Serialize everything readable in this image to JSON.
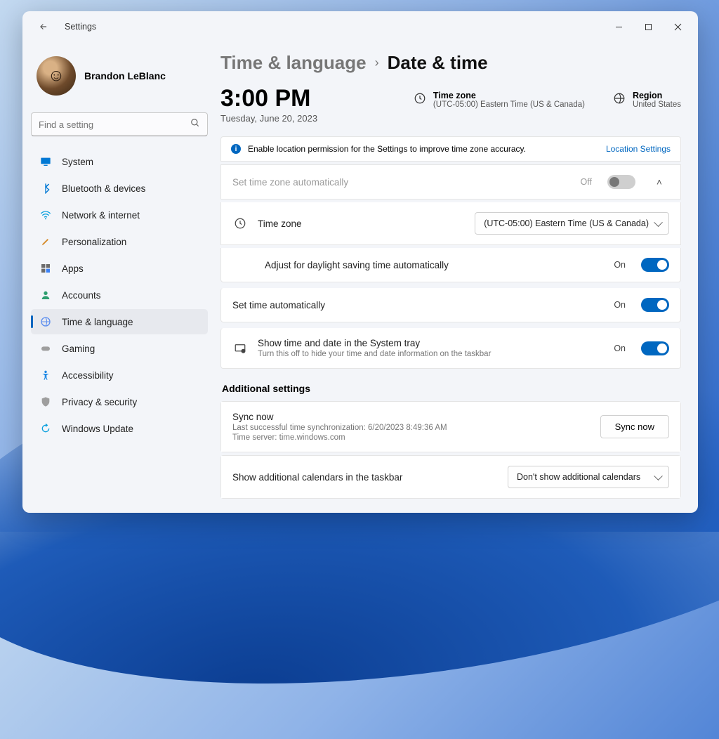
{
  "app_title": "Settings",
  "user": {
    "name": "Brandon LeBlanc"
  },
  "search": {
    "placeholder": "Find a setting"
  },
  "nav": [
    {
      "key": "system",
      "label": "System"
    },
    {
      "key": "bluetooth",
      "label": "Bluetooth & devices"
    },
    {
      "key": "network",
      "label": "Network & internet"
    },
    {
      "key": "personalization",
      "label": "Personalization"
    },
    {
      "key": "apps",
      "label": "Apps"
    },
    {
      "key": "accounts",
      "label": "Accounts"
    },
    {
      "key": "time",
      "label": "Time & language",
      "active": true
    },
    {
      "key": "gaming",
      "label": "Gaming"
    },
    {
      "key": "accessibility",
      "label": "Accessibility"
    },
    {
      "key": "privacy",
      "label": "Privacy & security"
    },
    {
      "key": "update",
      "label": "Windows Update"
    }
  ],
  "breadcrumb": {
    "parent": "Time & language",
    "current": "Date & time"
  },
  "clock": {
    "time": "3:00 PM",
    "date": "Tuesday, June 20, 2023"
  },
  "summary": {
    "timezone_label": "Time zone",
    "timezone_value": "(UTC-05:00) Eastern Time (US & Canada)",
    "region_label": "Region",
    "region_value": "United States"
  },
  "info_banner": {
    "text": "Enable location permission for the Settings to improve time zone accuracy.",
    "link": "Location Settings"
  },
  "rows": {
    "auto_tz": {
      "label": "Set time zone automatically",
      "state_label": "Off"
    },
    "tz": {
      "label": "Time zone",
      "selected": "(UTC-05:00) Eastern Time (US & Canada)"
    },
    "dst": {
      "label": "Adjust for daylight saving time automatically",
      "state_label": "On"
    },
    "auto_time": {
      "label": "Set time automatically",
      "state_label": "On"
    },
    "systray": {
      "label": "Show time and date in the System tray",
      "sub": "Turn this off to hide your time and date information on the taskbar",
      "state_label": "On"
    }
  },
  "additional_title": "Additional settings",
  "sync": {
    "title": "Sync now",
    "line1": "Last successful time synchronization: 6/20/2023 8:49:36 AM",
    "line2": "Time server: time.windows.com",
    "button": "Sync now"
  },
  "calendars": {
    "label": "Show additional calendars in the taskbar",
    "selected": "Don't show additional calendars"
  }
}
